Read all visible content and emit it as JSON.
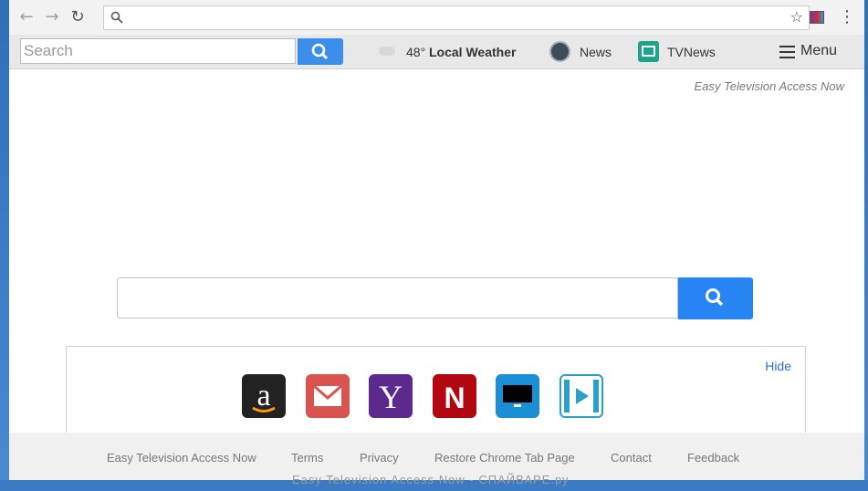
{
  "browser": {
    "back_icon": "arrow-left-icon",
    "forward_icon": "arrow-right-icon",
    "reload_icon": "reload-icon",
    "omnibox_value": "",
    "bookmark_icon": "star-icon",
    "menu_icon": "kebab-icon"
  },
  "toolbar": {
    "search_placeholder": "Search",
    "weather_temp": "48°",
    "weather_label": "Local Weather",
    "news_label": "News",
    "tvnews_label": "TVNews",
    "menu_label": "Menu"
  },
  "main": {
    "brand": "Easy Television Access Now",
    "search_value": "",
    "hide_label": "Hide",
    "shortcuts": [
      {
        "name": "amazon",
        "icon": "amazon-icon",
        "color": "#222222"
      },
      {
        "name": "gmail",
        "icon": "mail-icon",
        "color": "#d9534f"
      },
      {
        "name": "yahoo",
        "icon": "yahoo-icon",
        "color": "#5b2a8c"
      },
      {
        "name": "netflix",
        "icon": "netflix-icon",
        "color": "#b20710"
      },
      {
        "name": "tv",
        "icon": "monitor-icon",
        "color": "#1a8fd6"
      },
      {
        "name": "video",
        "icon": "video-icon",
        "color": "#2aa0c8"
      }
    ]
  },
  "footer": {
    "links": [
      "Easy Television Access Now",
      "Terms",
      "Privacy",
      "Restore Chrome Tab Page",
      "Contact",
      "Feedback"
    ],
    "ghost_text": "Easy  Television  Access  Now  -  СПАЙВАРЕ.ру"
  },
  "colors": {
    "accent": "#2684f3",
    "toolbar_bg": "#e8e8e8",
    "link": "#2a6fc9"
  }
}
